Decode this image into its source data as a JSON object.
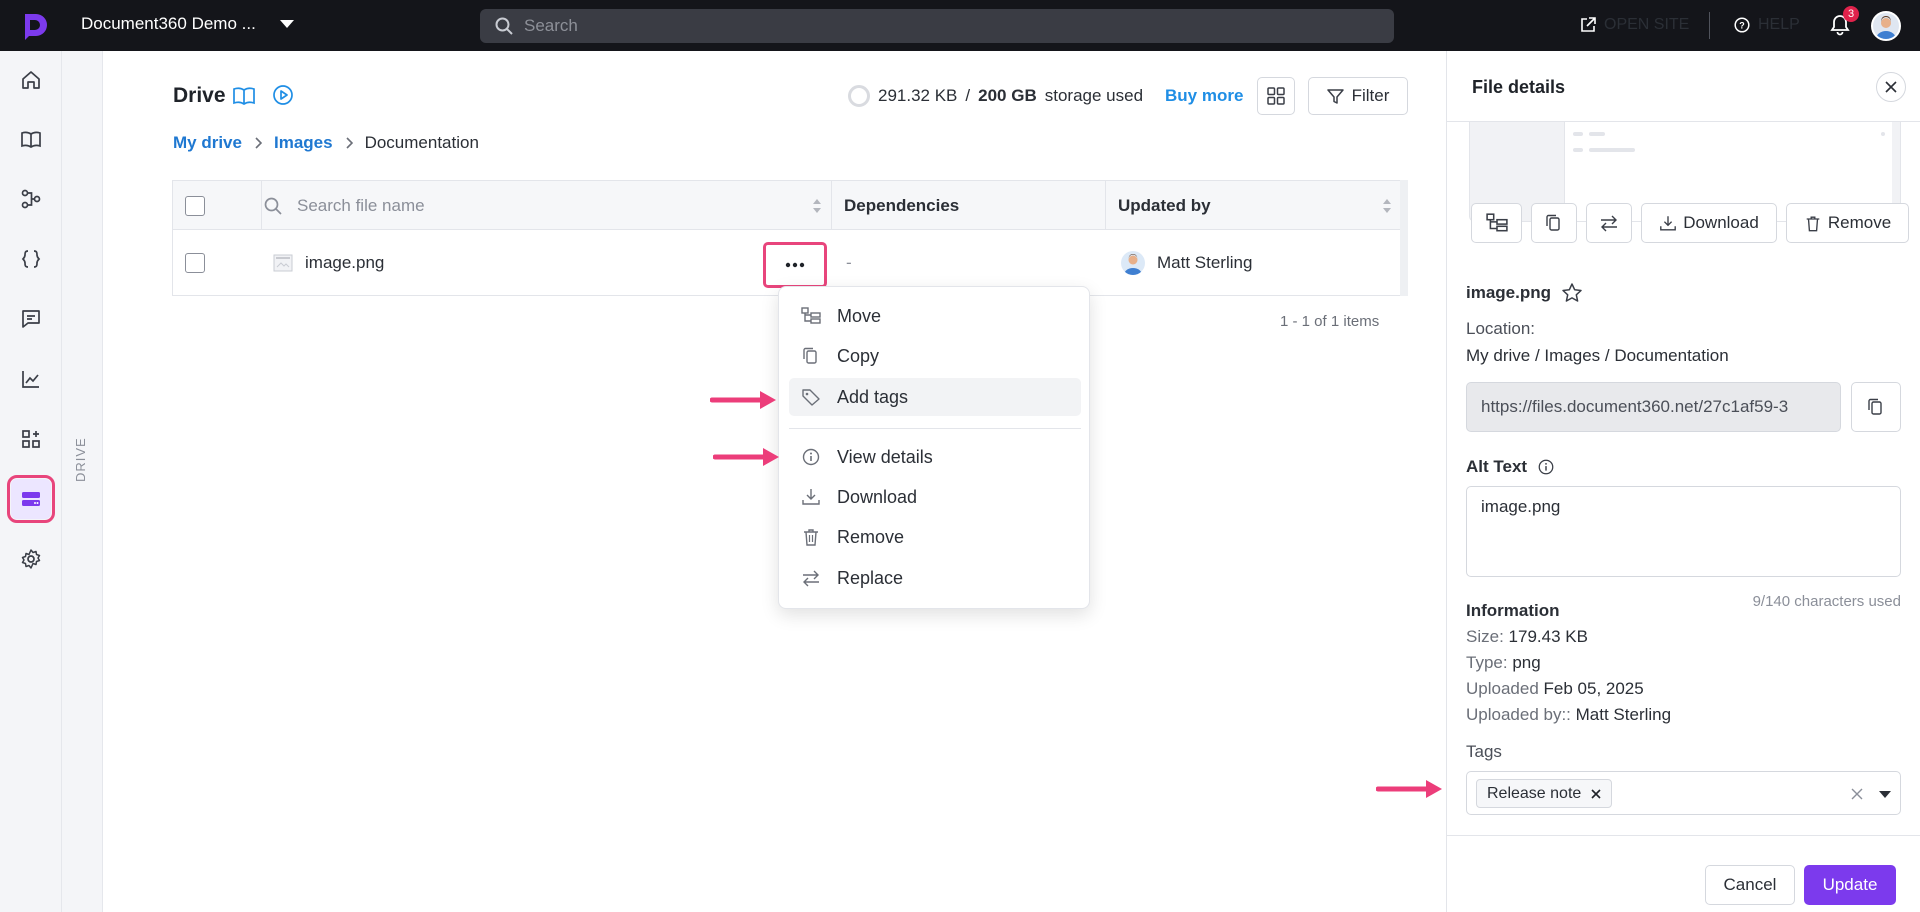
{
  "header": {
    "project_name": "Document360 Demo ...",
    "search_placeholder": "Search",
    "open_site_label": "OPEN SITE",
    "help_label": "HELP",
    "notification_count": "3"
  },
  "sidebar": {
    "items": [
      {
        "icon": "home-icon"
      },
      {
        "icon": "book-icon"
      },
      {
        "icon": "workflow-icon"
      },
      {
        "icon": "api-braces-icon"
      },
      {
        "icon": "feedback-icon"
      },
      {
        "icon": "analytics-icon"
      },
      {
        "icon": "integrations-icon"
      },
      {
        "icon": "drive-icon",
        "active": true
      },
      {
        "icon": "settings-icon"
      }
    ],
    "sub_label": "DRIVE"
  },
  "main": {
    "title": "Drive",
    "storage_used": "291.32 KB",
    "storage_separator": "/",
    "storage_total": "200 GB",
    "storage_suffix": "storage used",
    "buy_more": "Buy more",
    "filter_label": "Filter",
    "breadcrumb": [
      "My drive",
      "Images",
      "Documentation"
    ],
    "table": {
      "search_placeholder": "Search file name",
      "columns": [
        "Dependencies",
        "Updated by"
      ],
      "rows": [
        {
          "name": "image.png",
          "dependencies": "-",
          "updated_by": "Matt Sterling"
        }
      ]
    },
    "pagination": "1 - 1 of 1 items"
  },
  "context_menu": {
    "items": [
      "Move",
      "Copy",
      "Add tags",
      "View details",
      "Download",
      "Remove",
      "Replace"
    ]
  },
  "file_details": {
    "title": "File details",
    "actions": {
      "download": "Download",
      "remove": "Remove"
    },
    "file_name": "image.png",
    "location_label": "Location:",
    "location_value": "My drive / Images / Documentation",
    "url": "https://files.document360.net/27c1af59-3",
    "alt_text_label": "Alt Text",
    "alt_text_value": "image.png",
    "char_count": "9/140 characters used",
    "information_label": "Information",
    "size_label": "Size:",
    "size_value": "179.43 KB",
    "type_label": "Type:",
    "type_value": "png",
    "uploaded_label": "Uploaded",
    "uploaded_value": "Feb 05, 2025",
    "uploaded_by_label": "Uploaded by::",
    "uploaded_by_value": "Matt Sterling",
    "tags_label": "Tags",
    "tags": [
      "Release note"
    ],
    "cancel_label": "Cancel",
    "update_label": "Update"
  },
  "colors": {
    "accent": "#7c3aed",
    "highlight": "#e8457c",
    "link": "#1f78d1",
    "topbar": "#14151a"
  }
}
